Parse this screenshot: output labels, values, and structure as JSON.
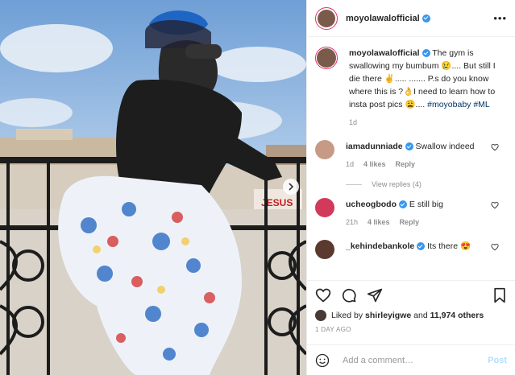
{
  "post": {
    "username": "moyolawalofficial",
    "more_icon": "more-options-icon",
    "caption": {
      "username": "moyolawalofficial",
      "text": " The gym is swallowing my bumbum 😢.... But still I die there ✌..... ....... P.s do you know where this is ?👌I need to learn how to insta post pics 😩.... ",
      "tag1": "#moyobaby",
      "tag2": "#ML",
      "time": "1d"
    },
    "comments": [
      {
        "username": "iamadunniade",
        "text": "Swallow indeed",
        "time": "1d",
        "likes": "4 likes",
        "reply": "Reply",
        "view_replies": "View replies (4)"
      },
      {
        "username": "ucheogbodo",
        "text": "E still big",
        "time": "21h",
        "likes": "4 likes",
        "reply": "Reply"
      },
      {
        "username": "_kehindebankole",
        "text": "Its there 😍"
      }
    ],
    "liked_by": {
      "prefix": "Liked by ",
      "user": "shirleyigwe",
      "middle": " and ",
      "count": "11,974 others"
    },
    "ago": "1 DAY AGO",
    "add_comment": {
      "placeholder": "Add a comment…",
      "post_label": "Post"
    },
    "colors": {
      "verified": "#3897f0",
      "tag": "#003569",
      "post_button": "#b2dffc",
      "story_ring": "#e1306c"
    }
  }
}
